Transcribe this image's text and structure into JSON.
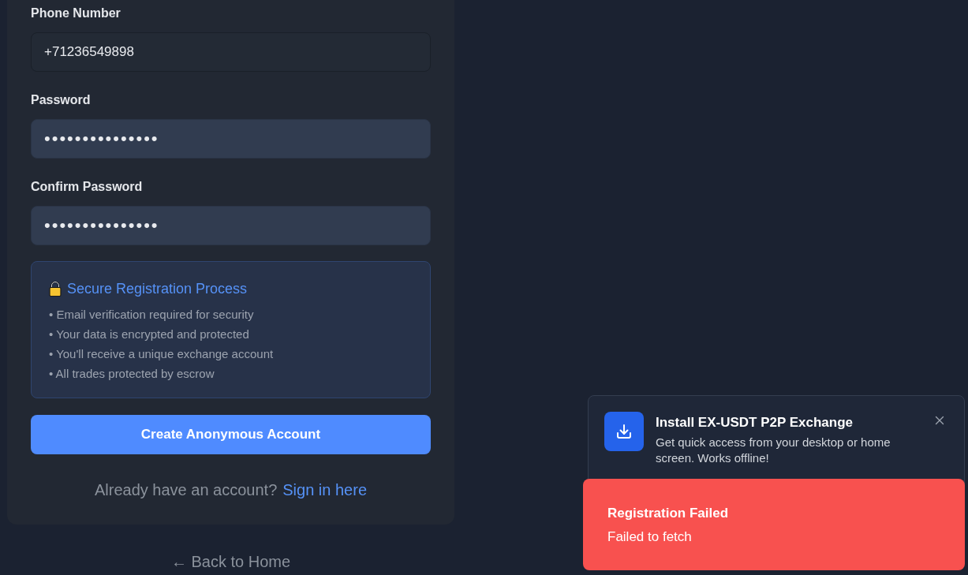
{
  "form": {
    "fields": [
      {
        "kind": "text",
        "label": "Phone Number",
        "value": "+71236549898"
      },
      {
        "kind": "password",
        "label": "Password",
        "value": "•••••••••••••••"
      },
      {
        "kind": "password",
        "label": "Confirm Password",
        "value": "•••••••••••••••"
      }
    ],
    "notice": {
      "title": "Secure Registration Process",
      "items": [
        "• Email verification required for security",
        "• Your data is encrypted and protected",
        "• You'll receive a unique exchange account",
        "• All trades protected by escrow"
      ]
    },
    "submit_button": "Create Anonymous Account",
    "signin": {
      "text": "Already have an account?",
      "link": "Sign in here"
    }
  },
  "back_link": "← Back to Home",
  "install_prompt": {
    "title": "Install EX-USDT P2P Exchange",
    "description": "Get quick access from your desktop or home screen. Works offline!"
  },
  "toast": {
    "kind": "error",
    "title": "Registration Failed",
    "message": "Failed to fetch"
  }
}
